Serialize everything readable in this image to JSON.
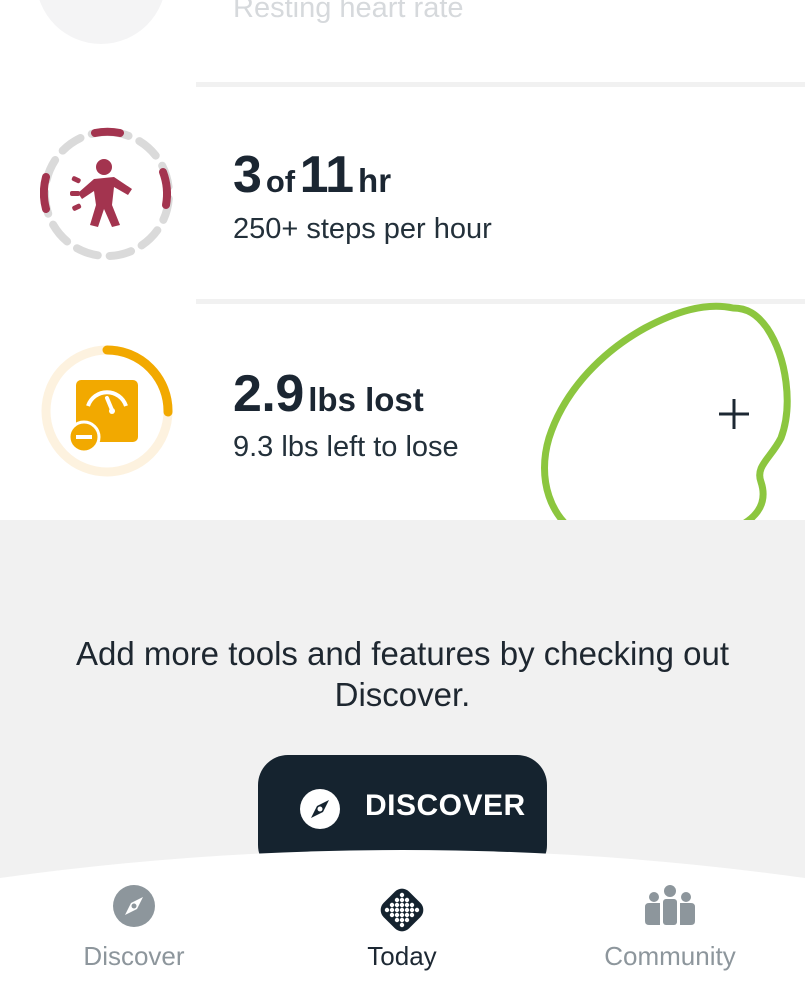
{
  "resting": {
    "label": "Resting heart rate"
  },
  "hourly": {
    "current": "3",
    "of_word": "of",
    "goal": "11",
    "unit": "hr",
    "subtitle": "250+ steps per hour",
    "ring_color": "#a3344f",
    "icon": "person-activity-icon"
  },
  "weight": {
    "value": "2.9",
    "unit": "lbs lost",
    "subtitle": "9.3 lbs left to lose",
    "ring_color": "#f2a900",
    "icon": "scale-icon"
  },
  "add_button": {
    "label": "+",
    "highlight_color": "#8cc63f"
  },
  "promo": {
    "text": "Add more tools and features by checking out Discover.",
    "button_label": "DISCOVER",
    "button_icon": "compass-icon"
  },
  "nav": {
    "items": [
      {
        "label": "Discover",
        "icon": "compass-icon",
        "active": false
      },
      {
        "label": "Today",
        "icon": "fitbit-dots-icon",
        "active": true
      },
      {
        "label": "Community",
        "icon": "community-icon",
        "active": false
      }
    ]
  }
}
